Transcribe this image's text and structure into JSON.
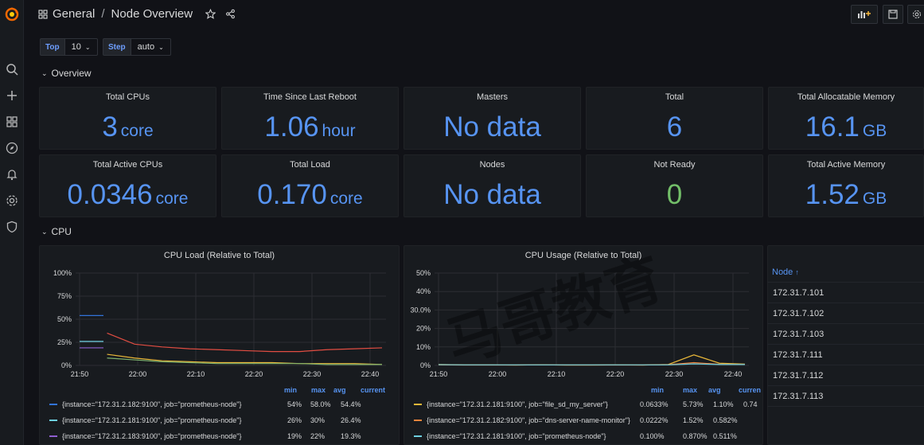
{
  "breadcrumb": {
    "folder": "General",
    "separator": "/",
    "title": "Node Overview"
  },
  "variables": [
    {
      "label": "Top",
      "value": "10"
    },
    {
      "label": "Step",
      "value": "auto"
    }
  ],
  "rows": {
    "overview": "Overview",
    "cpu": "CPU"
  },
  "stats": [
    {
      "title": "Total CPUs",
      "value": "3",
      "unit": "core",
      "color": "#5794f2"
    },
    {
      "title": "Time Since Last Reboot",
      "value": "1.06",
      "unit": "hour",
      "color": "#5794f2"
    },
    {
      "title": "Masters",
      "value": "No data",
      "unit": "",
      "color": "#5794f2"
    },
    {
      "title": "Total",
      "value": "6",
      "unit": "",
      "color": "#5794f2"
    },
    {
      "title": "Total Allocatable Memory",
      "value": "16.1",
      "unit": "GB",
      "color": "#5794f2"
    },
    {
      "title": "Total Active CPUs",
      "value": "0.0346",
      "unit": "core",
      "color": "#5794f2"
    },
    {
      "title": "Total Load",
      "value": "0.170",
      "unit": "core",
      "color": "#5794f2"
    },
    {
      "title": "Nodes",
      "value": "No data",
      "unit": "",
      "color": "#5794f2"
    },
    {
      "title": "Not Ready",
      "value": "0",
      "unit": "",
      "color": "#73bf69"
    },
    {
      "title": "Total Active Memory",
      "value": "1.52",
      "unit": "GB",
      "color": "#5794f2"
    }
  ],
  "cpu_load": {
    "title": "CPU Load (Relative to Total)",
    "legend_headers": [
      "min",
      "max",
      "avg",
      "current"
    ],
    "legend": [
      {
        "label": "{instance=\"172.31.2.182:9100\", job=\"prometheus-node\"}",
        "color": "#3274d9",
        "min": "54%",
        "max": "58.0%",
        "avg": "54.4%",
        "current": ""
      },
      {
        "label": "{instance=\"172.31.2.181:9100\", job=\"prometheus-node\"}",
        "color": "#6ed0e0",
        "min": "26%",
        "max": "30%",
        "avg": "26.4%",
        "current": ""
      },
      {
        "label": "{instance=\"172.31.2.183:9100\", job=\"prometheus-node\"}",
        "color": "#8f5fd1",
        "min": "19%",
        "max": "22%",
        "avg": "19.3%",
        "current": ""
      }
    ]
  },
  "cpu_usage": {
    "title": "CPU Usage (Relative to Total)",
    "legend_headers": [
      "min",
      "max",
      "avg",
      "curren"
    ],
    "legend": [
      {
        "label": "{instance=\"172.31.2.181:9100\", job=\"file_sd_my_server\"}",
        "color": "#eab839",
        "min": "0.0633%",
        "max": "5.73%",
        "avg": "1.10%",
        "current": "0.74"
      },
      {
        "label": "{instance=\"172.31.2.182:9100\", job=\"dns-server-name-monitor\"}",
        "color": "#ef843c",
        "min": "0.0222%",
        "max": "1.52%",
        "avg": "0.582%",
        "current": ""
      },
      {
        "label": "{instance=\"172.31.2.181:9100\", job=\"prometheus-node\"}",
        "color": "#6ed0e0",
        "min": "0.100%",
        "max": "0.870%",
        "avg": "0.511%",
        "current": ""
      }
    ]
  },
  "node_table": {
    "header": "Node",
    "sort_icon": "arrow-up-icon",
    "rows": [
      "172.31.7.101",
      "172.31.7.102",
      "172.31.7.103",
      "172.31.7.111",
      "172.31.7.112",
      "172.31.7.113"
    ]
  },
  "chart_data": [
    {
      "type": "line",
      "title": "CPU Load (Relative to Total)",
      "x_ticks": [
        "21:50",
        "22:00",
        "22:10",
        "22:20",
        "22:30",
        "22:40"
      ],
      "y_ticks": [
        "0%",
        "25%",
        "50%",
        "75%",
        "100%"
      ],
      "ylim": [
        0,
        100
      ],
      "x": [
        "21:50",
        "21:55",
        "22:00",
        "22:05",
        "22:10",
        "22:15",
        "22:20",
        "22:25",
        "22:30",
        "22:35",
        "22:40",
        "22:45"
      ],
      "series": [
        {
          "color": "#3274d9",
          "values": [
            54,
            null,
            null,
            null,
            null,
            null,
            null,
            null,
            null,
            null,
            null,
            null
          ]
        },
        {
          "color": "#6ed0e0",
          "values": [
            26,
            null,
            null,
            null,
            null,
            null,
            null,
            null,
            null,
            null,
            null,
            null
          ]
        },
        {
          "color": "#8f5fd1",
          "values": [
            19,
            null,
            null,
            null,
            null,
            null,
            null,
            null,
            null,
            null,
            null,
            null
          ]
        },
        {
          "color": "#e24d42",
          "values": [
            null,
            35,
            23,
            20,
            18,
            17,
            16,
            15,
            15,
            17,
            18,
            19
          ]
        },
        {
          "color": "#eab839",
          "values": [
            null,
            12,
            8,
            5,
            4,
            3,
            3,
            3,
            2,
            2,
            2,
            1
          ]
        },
        {
          "color": "#7eb26d",
          "values": [
            null,
            8,
            6,
            4,
            3,
            2,
            2,
            2,
            2,
            1,
            1,
            1
          ]
        }
      ]
    },
    {
      "type": "line",
      "title": "CPU Usage (Relative to Total)",
      "x_ticks": [
        "21:50",
        "22:00",
        "22:10",
        "22:20",
        "22:30",
        "22:40"
      ],
      "y_ticks": [
        "0%",
        "10%",
        "20%",
        "30.0%",
        "40%",
        "50%"
      ],
      "ylim": [
        0,
        50
      ],
      "x": [
        "21:50",
        "21:55",
        "22:00",
        "22:05",
        "22:10",
        "22:15",
        "22:20",
        "22:25",
        "22:30",
        "22:35",
        "22:38",
        "22:40",
        "22:45"
      ],
      "series": [
        {
          "color": "#eab839",
          "values": [
            0.5,
            0.3,
            0.3,
            0.2,
            0.3,
            0.2,
            0.2,
            0.3,
            0.2,
            0.5,
            5.7,
            1.2,
            0.7
          ]
        },
        {
          "color": "#ef843c",
          "values": [
            0.3,
            0.2,
            0.2,
            0.2,
            0.3,
            0.2,
            0.2,
            0.2,
            0.2,
            0.4,
            1.5,
            0.6,
            0.5
          ]
        },
        {
          "color": "#6ed0e0",
          "values": [
            0.4,
            0.3,
            0.3,
            0.3,
            0.3,
            0.3,
            0.3,
            0.3,
            0.3,
            0.3,
            0.8,
            0.5,
            0.5
          ]
        }
      ]
    }
  ]
}
